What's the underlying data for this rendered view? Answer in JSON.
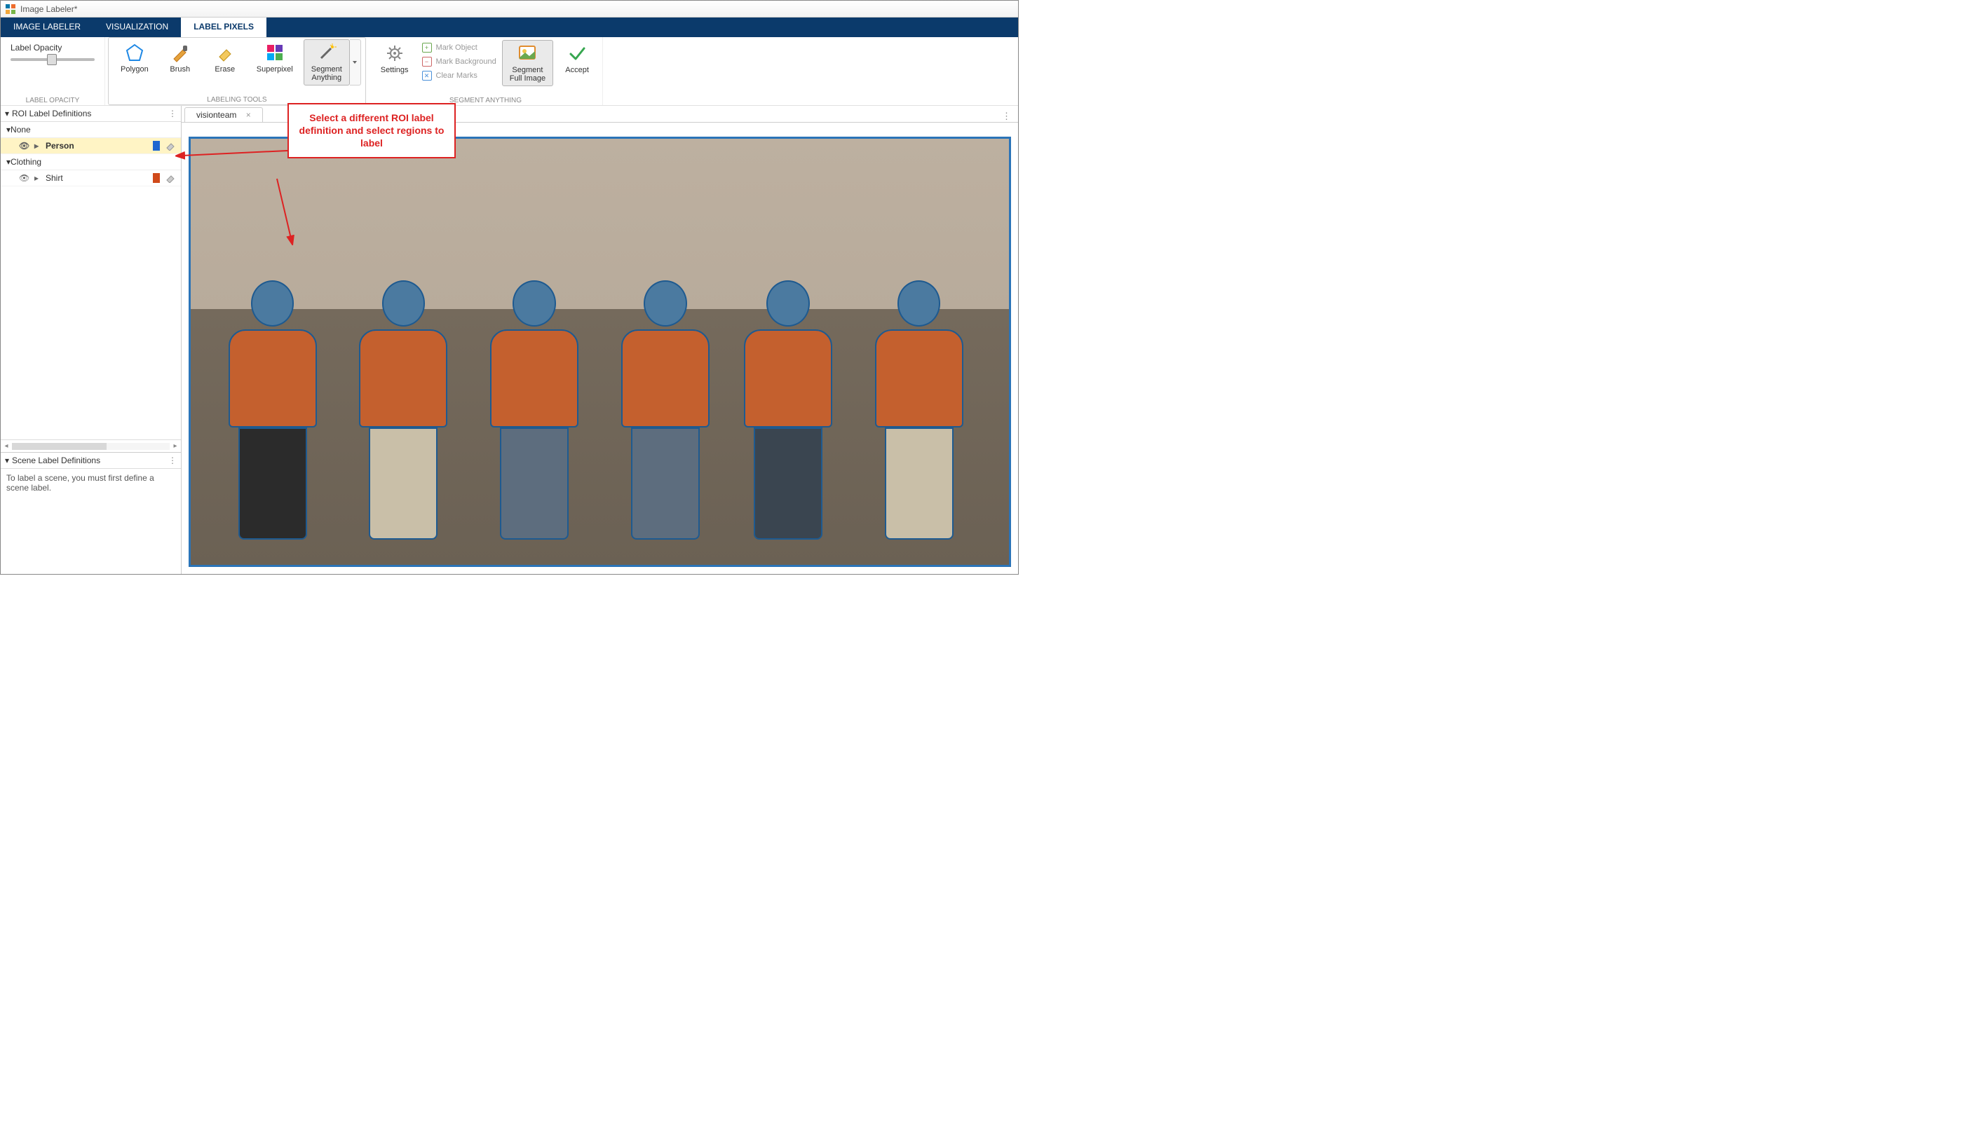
{
  "window": {
    "title": "Image Labeler*"
  },
  "tabs": {
    "items": [
      "IMAGE LABELER",
      "VISUALIZATION",
      "LABEL PIXELS"
    ],
    "active_index": 2
  },
  "ribbon": {
    "opacity": {
      "label": "Label Opacity",
      "group_label": "LABEL OPACITY"
    },
    "tools": {
      "group_label": "LABELING TOOLS",
      "polygon": "Polygon",
      "brush": "Brush",
      "erase": "Erase",
      "superpixel": "Superpixel",
      "segment_anything": "Segment\nAnything"
    },
    "segment": {
      "group_label": "SEGMENT ANYTHING",
      "settings": "Settings",
      "mark_object": "Mark Object",
      "mark_background": "Mark Background",
      "clear_marks": "Clear Marks",
      "segment_full_image": "Segment\nFull Image",
      "accept": "Accept"
    }
  },
  "roi_panel": {
    "header": "ROI Label Definitions",
    "groups": [
      {
        "name": "None",
        "items": [
          {
            "name": "Person",
            "color": "#1e66d0",
            "selected": true
          }
        ]
      },
      {
        "name": "Clothing",
        "items": [
          {
            "name": "Shirt",
            "color": "#d04a1a",
            "selected": false
          }
        ]
      }
    ]
  },
  "scene_panel": {
    "header": "Scene Label Definitions",
    "body": "To label a scene, you must first define a scene label."
  },
  "file_tab": {
    "name": "visionteam"
  },
  "callout": {
    "text": "Select a different ROI label definition and select regions to label"
  }
}
